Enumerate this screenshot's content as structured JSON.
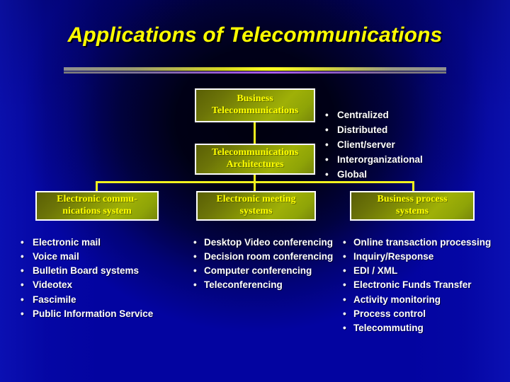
{
  "slide": {
    "title": "Applications of Telecommunications",
    "colors": {
      "background_blue": "#0304a0",
      "background_dark": "#000028",
      "title_yellow": "#ffff00",
      "box_green_light": "#9fb007",
      "box_green_dark": "#5a5f06",
      "box_border_white": "#ffffff",
      "connector_yellow": "#f2f21e",
      "bullet_white": "#ffffff",
      "divider_gray": "#8f8f8f",
      "divider_yellow": "#ffff20",
      "divider_purple": "#a85ce8"
    }
  },
  "boxes": {
    "business": "Business Telecommunications",
    "architectures": "Telecommunications Architectures",
    "electronic_comm_line1": "Electronic commu-",
    "electronic_comm_line2": "nications system",
    "meeting_line1": "Electronic meeting",
    "meeting_line2": "systems",
    "business_process_line1": "Business process",
    "business_process_line2": "systems"
  },
  "bullet_glyph": "•",
  "bullet_lists": {
    "architectures": [
      "Centralized",
      "Distributed",
      "Client/server",
      "Interorganizational",
      "Global"
    ],
    "electronic_communications": [
      "Electronic mail",
      "Voice mail",
      "Bulletin Board systems",
      "Videotex",
      "Fascimile",
      "Public Information Service"
    ],
    "electronic_meeting": [
      "Desktop Video conferencing",
      "Decision room conferencing",
      "Computer conferencing",
      "Teleconferencing"
    ],
    "business_process": [
      "Online transaction processing",
      "Inquiry/Response",
      "EDI / XML",
      "Electronic Funds Transfer",
      "Activity monitoring",
      "Process control",
      "Telecommuting"
    ]
  }
}
